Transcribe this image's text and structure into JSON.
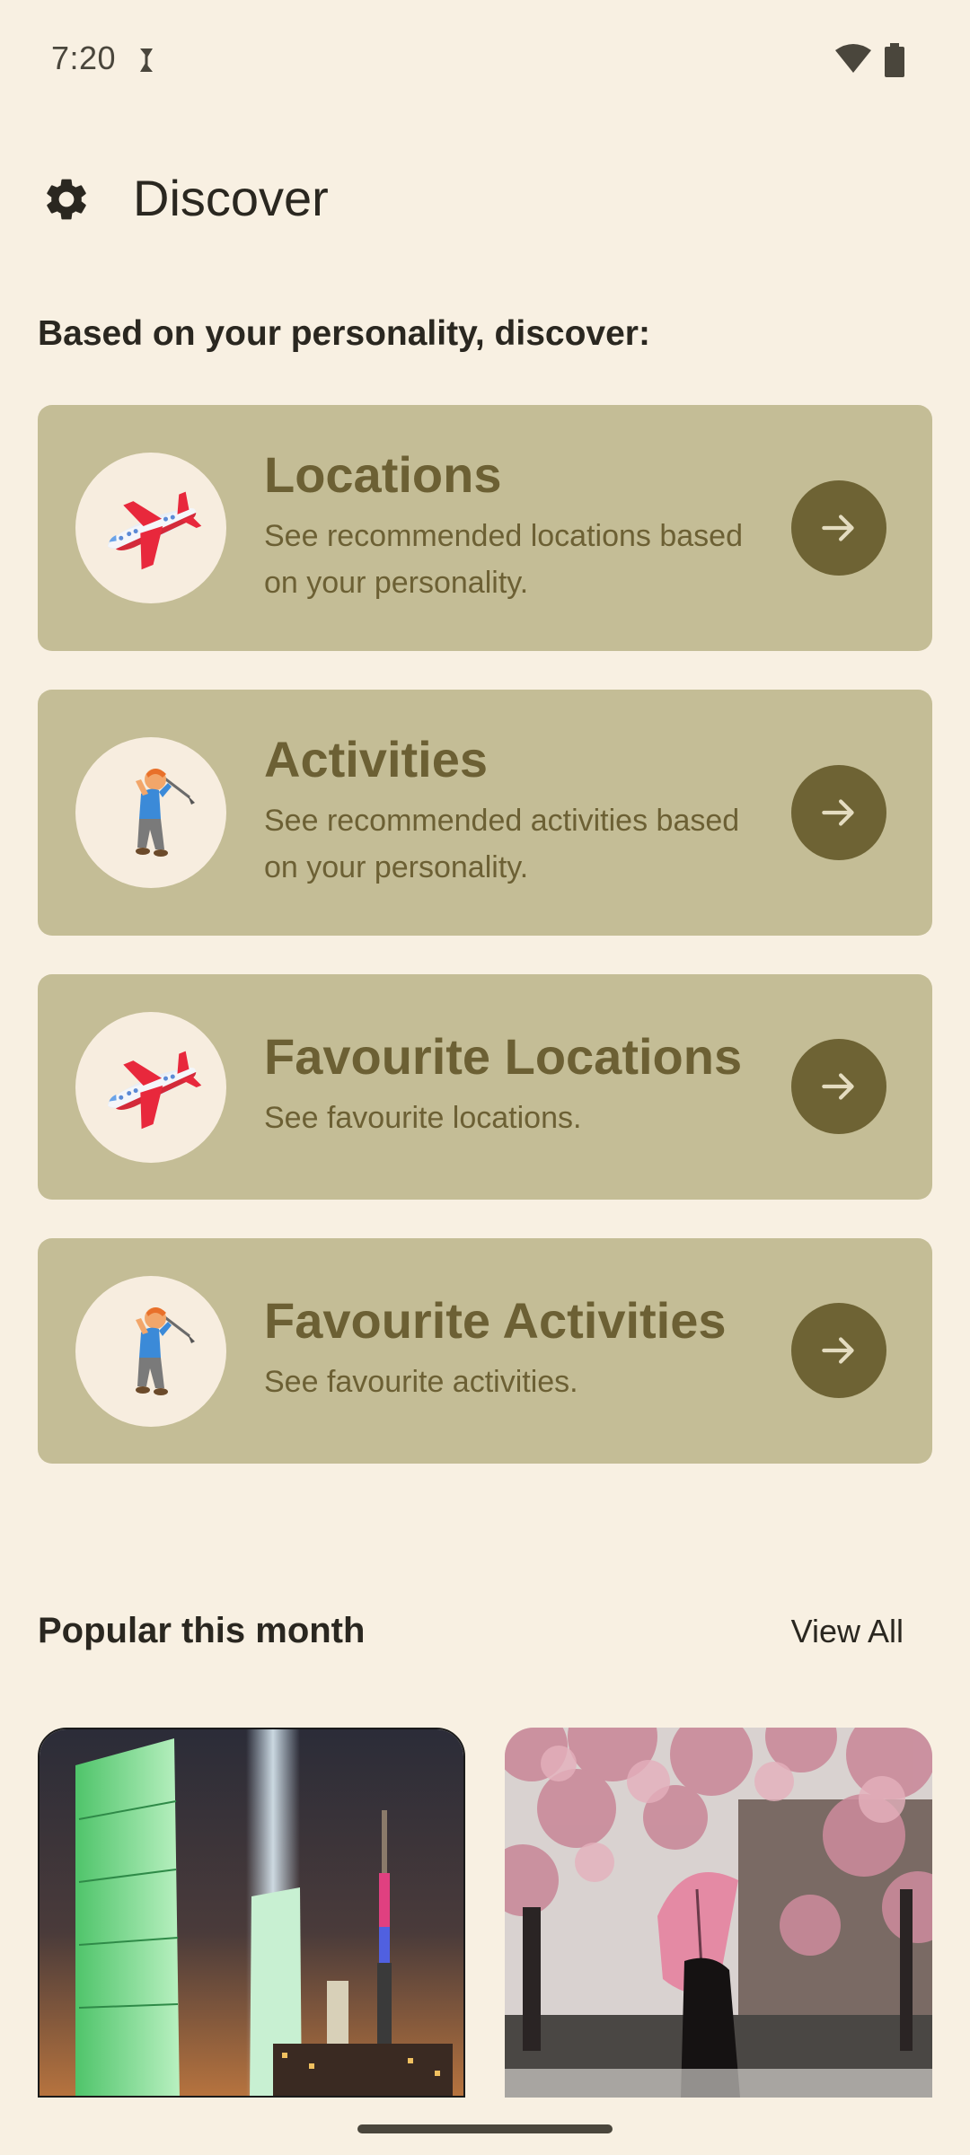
{
  "status_bar": {
    "time": "7:20",
    "icons": [
      "sync-icon",
      "wifi-icon",
      "battery-icon"
    ]
  },
  "header": {
    "title": "Discover",
    "settings_icon": "gear-icon"
  },
  "discover": {
    "heading": "Based on your personality, discover:",
    "cards": [
      {
        "title": "Locations",
        "description": "See recommended locations based on your personality.",
        "icon": "airplane-icon"
      },
      {
        "title": "Activities",
        "description": "See recommended activities based on your personality.",
        "icon": "golfer-icon"
      },
      {
        "title": "Favourite Locations",
        "description": "See favourite locations.",
        "icon": "airplane-icon"
      },
      {
        "title": "Favourite Activities",
        "description": "See favourite activities.",
        "icon": "golfer-icon"
      }
    ]
  },
  "popular": {
    "title": "Popular this month",
    "view_all": "View All"
  },
  "colors": {
    "background": "#f8f0e2",
    "card": "#c4bd96",
    "card_text": "#6c6034",
    "arrow_button": "#6e6334",
    "avatar_bg": "#f7eddf"
  }
}
